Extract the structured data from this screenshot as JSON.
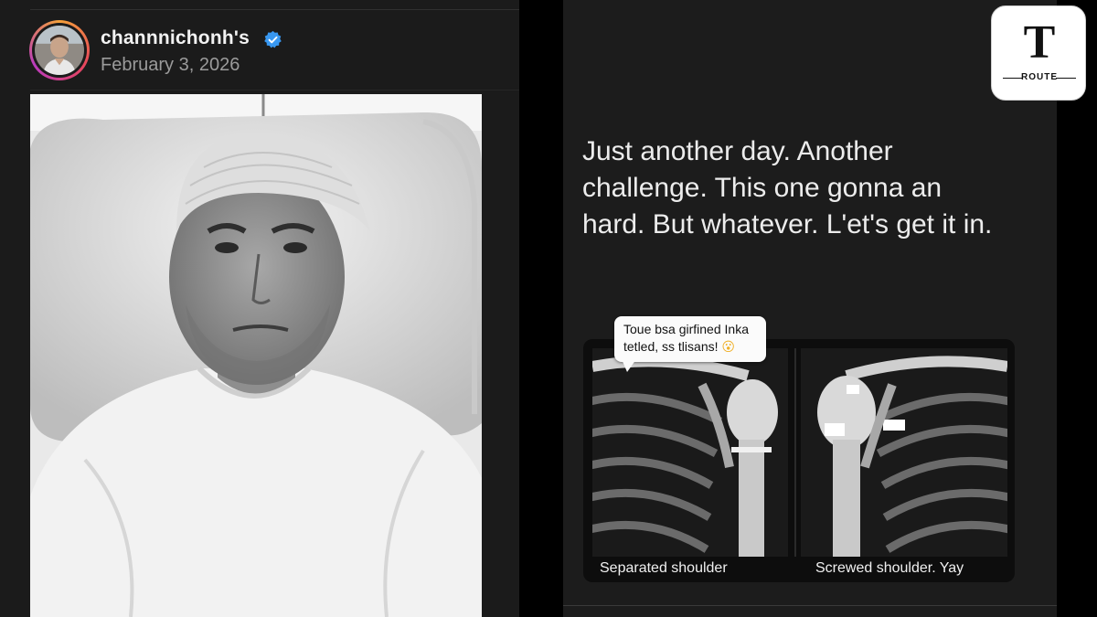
{
  "post": {
    "username": "channnichonh's",
    "verified": true,
    "date": "February 3, 2026",
    "caption_lines": [
      "Just another day. Another",
      "challenge. This one gonna an",
      "hard. But whatever. L'et's get it in."
    ]
  },
  "xray_card": {
    "bubble_lines": [
      "Toue bsa girfined Inka",
      "tetled, ss tlisans!"
    ],
    "bubble_emoji": "😮",
    "left_label": "Separated shoulder",
    "right_label": "Screwed shoulder. Yay"
  },
  "brand": {
    "letter": "T",
    "word": "ROUTE"
  },
  "icons": {
    "verified_badge": "verified-check-icon",
    "avatar": "profile-avatar"
  },
  "colors": {
    "background": "#000000",
    "panel": "#1b1b1b",
    "verified_blue": "#3897f0",
    "caption_text": "#ececec",
    "date_text": "#9b9b9b"
  }
}
